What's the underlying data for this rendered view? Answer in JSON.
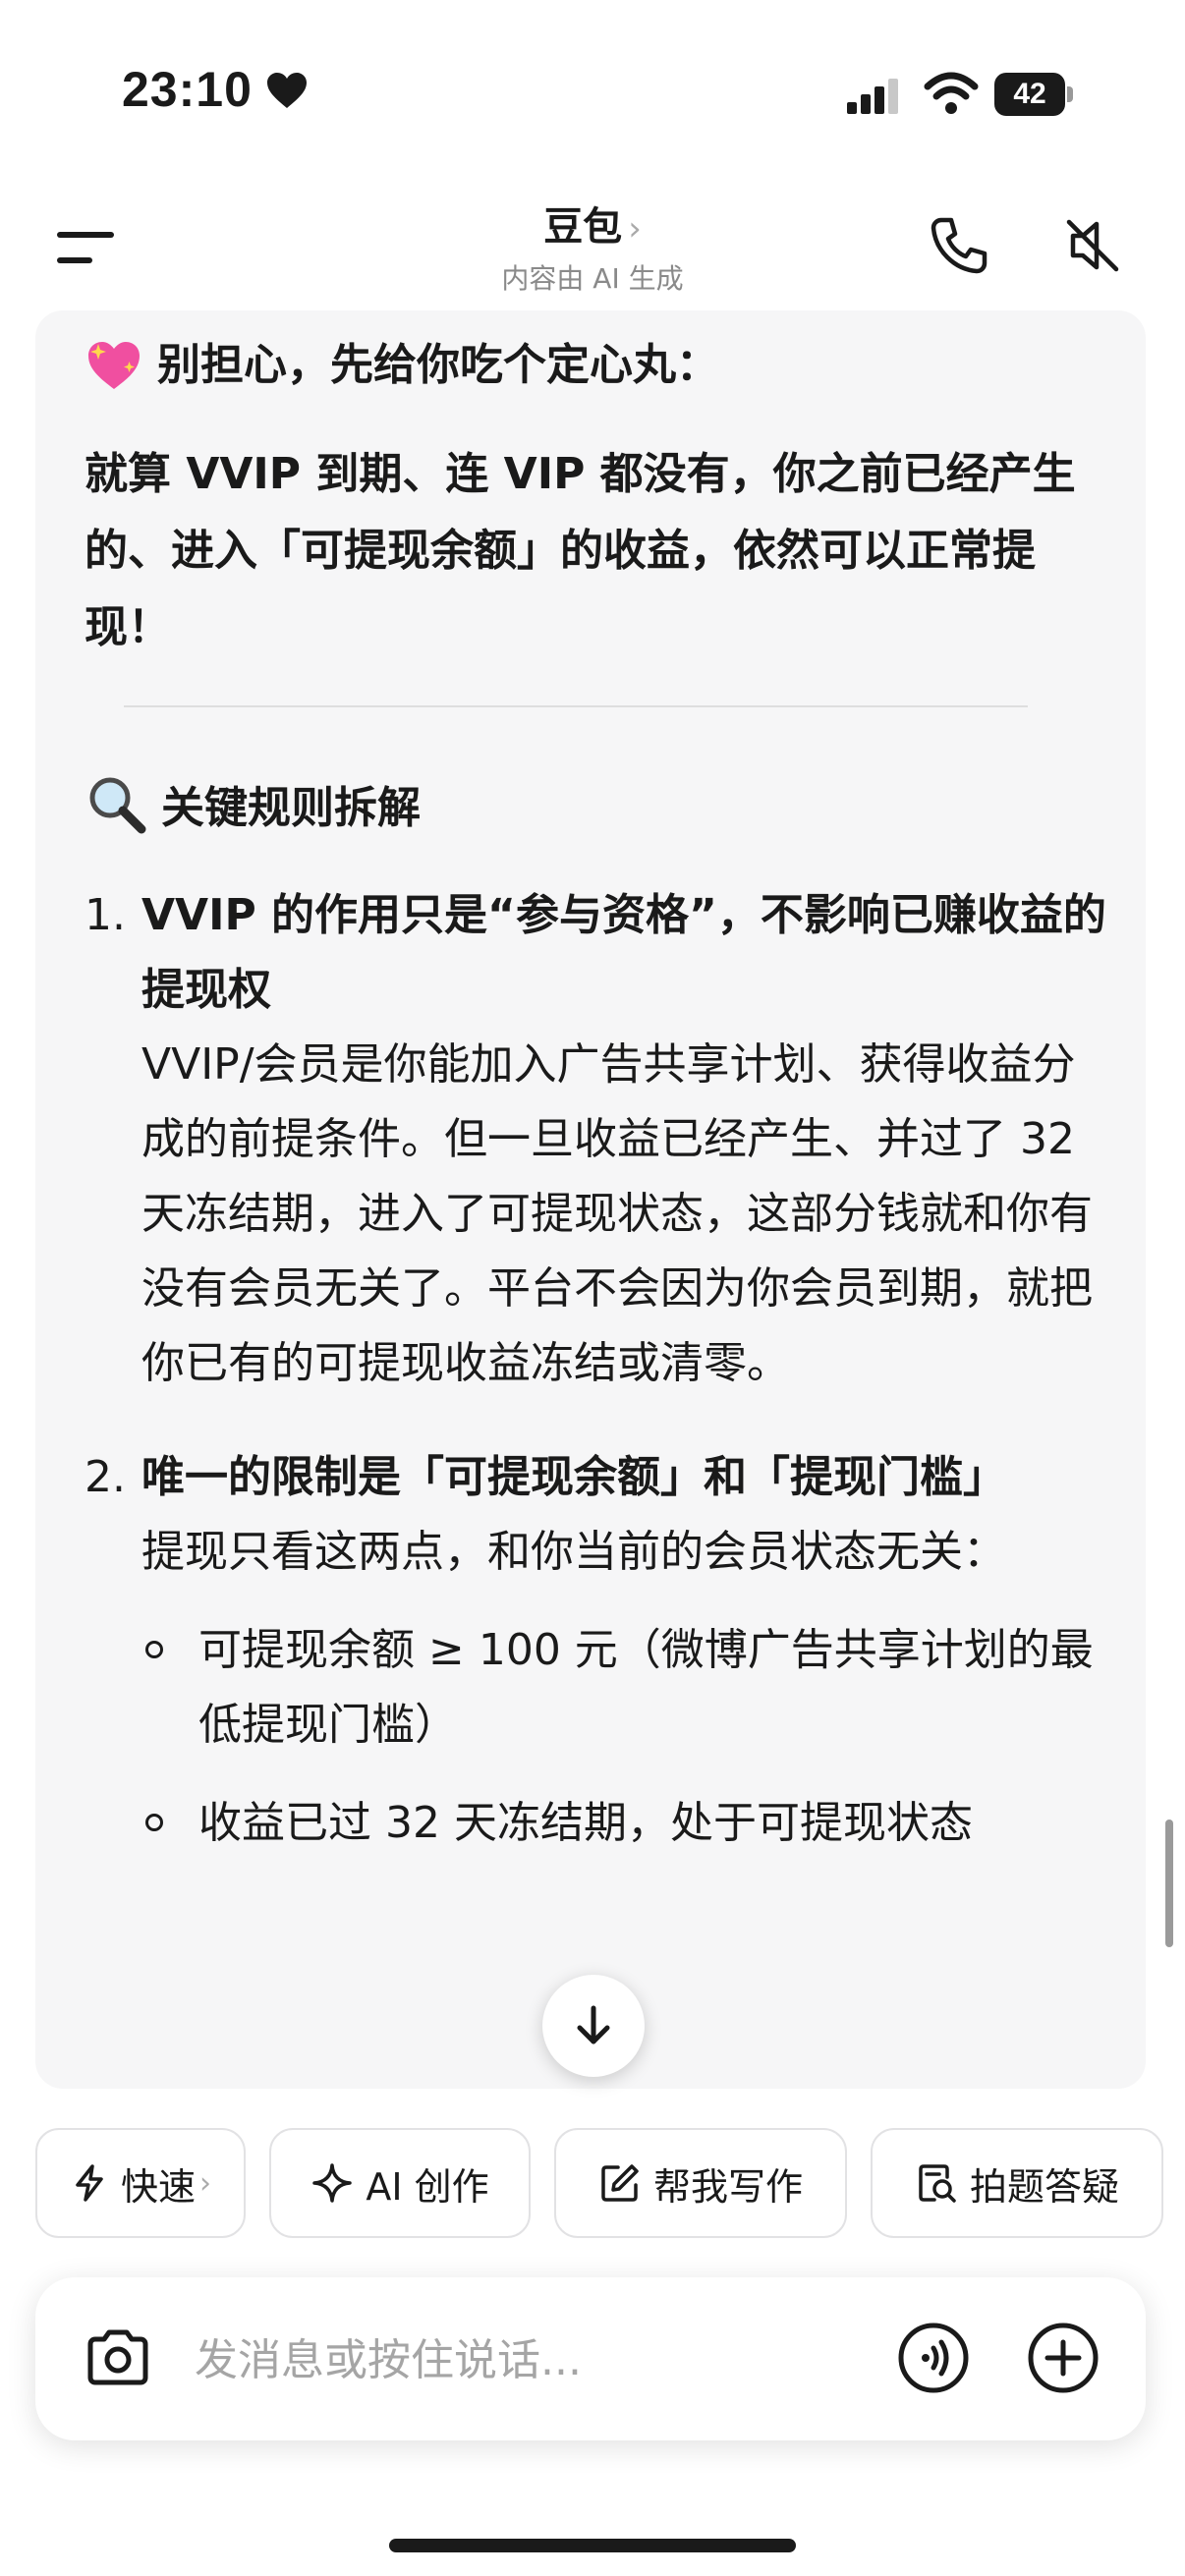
{
  "status_bar": {
    "time": "23:10",
    "battery": "42"
  },
  "header": {
    "title": "豆包",
    "title_chevron": "›",
    "subtitle": "内容由 AI 生成"
  },
  "message": {
    "reassure_line": "别担心，先给你吃个定心丸：",
    "bold_paragraph": "就算 VVIP 到期、连 VIP 都没有，你之前已经产生的、进入「可提现余额」的收益，依然可以正常提现！",
    "section_heading": "关键规则拆解",
    "items": [
      {
        "number": "1.",
        "title": "VVIP 的作用只是“参与资格”，不影响已赚收益的提现权",
        "body": "VVIP/会员是你能加入广告共享计划、获得收益分成的前提条件。但一旦收益已经产生、并过了 32 天冻结期，进入了可提现状态，这部分钱就和你有没有会员无关了。平台不会因为你会员到期，就把你已有的可提现收益冻结或清零。"
      },
      {
        "number": "2.",
        "title": "唯一的限制是「可提现余额」和「提现门槛」",
        "body": "提现只看这两点，和你当前的会员状态无关："
      }
    ],
    "sub_items": [
      "可提现余额 ≥ 100 元（微博广告共享计划的最低提现门槛）",
      "收益已过 32 天冻结期，处于可提现状态"
    ]
  },
  "chips": [
    {
      "label": "快速",
      "icon": "lightning-icon",
      "has_chevron": true,
      "chevron": "›"
    },
    {
      "label": "AI 创作",
      "icon": "sparkle-icon"
    },
    {
      "label": "帮我写作",
      "icon": "edit-icon"
    },
    {
      "label": "拍题答疑",
      "icon": "search-doc-icon"
    }
  ],
  "input": {
    "placeholder": "发消息或按住说话..."
  },
  "colors": {
    "card_background": "#f6f6f7",
    "text": "#1a1a1a",
    "muted": "#8a8a8a"
  }
}
